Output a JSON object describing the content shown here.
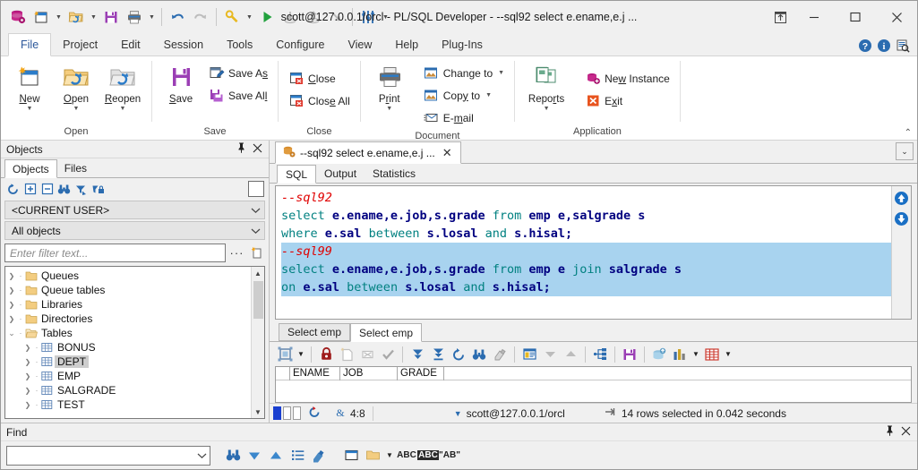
{
  "window": {
    "title": "scott@127.0.0.1/orcl - PL/SQL Developer - --sql92 select e.ename,e.j ...",
    "minimize": "—",
    "maximize": "▭",
    "close": "✕",
    "restore_icon": "restore-down-icon"
  },
  "quick_access": {
    "items": [
      {
        "name": "database-icon",
        "label": "Session"
      },
      {
        "name": "new-file-icon",
        "label": "New"
      },
      {
        "name": "open-folder-icon",
        "label": "Open"
      },
      {
        "name": "save-icon",
        "label": "Save"
      },
      {
        "name": "print-icon",
        "label": "Print"
      },
      {
        "name": "undo-icon",
        "label": "Undo"
      },
      {
        "name": "redo-icon",
        "label": "Redo"
      },
      {
        "name": "flashlight-icon",
        "label": "Explain Plan"
      },
      {
        "name": "execute-icon",
        "label": "Execute"
      },
      {
        "name": "commit-icon",
        "label": "Commit"
      },
      {
        "name": "rollback-icon",
        "label": "Rollback"
      },
      {
        "name": "break-icon",
        "label": "Break"
      },
      {
        "name": "preferences-icon",
        "label": "Preferences"
      }
    ]
  },
  "ribbon": {
    "tabs": [
      {
        "label": "File",
        "active": true
      },
      {
        "label": "Project",
        "active": false
      },
      {
        "label": "Edit",
        "active": false
      },
      {
        "label": "Session",
        "active": false
      },
      {
        "label": "Tools",
        "active": false
      },
      {
        "label": "Configure",
        "active": false
      },
      {
        "label": "View",
        "active": false
      },
      {
        "label": "Help",
        "active": false
      },
      {
        "label": "Plug-Ins",
        "active": false
      }
    ],
    "help_icons": [
      "help-icon",
      "info-icon",
      "find-document-icon"
    ],
    "collapse": "⌃",
    "groups": [
      {
        "title": "Open",
        "big_buttons": [
          {
            "label_pre": "",
            "label_u": "N",
            "label_post": "ew",
            "icon": "new-window-icon",
            "caret": true
          },
          {
            "label_pre": "",
            "label_u": "O",
            "label_post": "pen",
            "icon": "open-folder-icon",
            "caret": true
          },
          {
            "label_pre": "",
            "label_u": "R",
            "label_post": "eopen",
            "icon": "reopen-folder-icon",
            "caret": true
          }
        ]
      },
      {
        "title": "Save",
        "big_buttons": [
          {
            "label_pre": "",
            "label_u": "S",
            "label_post": "ave",
            "icon": "save-disk-icon",
            "caret": false
          }
        ],
        "small_buttons": [
          {
            "pre": "Save A",
            "u": "s",
            "post": "",
            "icon": "save-as-icon"
          },
          {
            "pre": "Save Al",
            "u": "l",
            "post": "",
            "icon": "save-all-icon"
          }
        ]
      },
      {
        "title": "Close",
        "small_buttons": [
          {
            "pre": "",
            "u": "C",
            "post": "lose",
            "icon": "close-window-icon"
          },
          {
            "pre": "Clos",
            "u": "e",
            "post": " All",
            "icon": "close-all-icon"
          }
        ]
      },
      {
        "title": "Document",
        "big_buttons": [
          {
            "label_pre": "P",
            "label_u": "r",
            "label_post": "int",
            "icon": "printer-icon",
            "caret": true
          }
        ],
        "small_buttons": [
          {
            "pre": "Chan",
            "u": "g",
            "post": "e to",
            "icon": "change-to-icon",
            "caret": true
          },
          {
            "pre": "Cop",
            "u": "y",
            "post": " to",
            "icon": "copy-to-icon",
            "caret": true
          },
          {
            "pre": "E-",
            "u": "m",
            "post": "ail",
            "icon": "email-icon"
          }
        ]
      },
      {
        "title": "Application",
        "big_buttons": [
          {
            "label_pre": "Repo",
            "label_u": "r",
            "label_post": "ts",
            "icon": "reports-icon",
            "caret": true
          }
        ],
        "small_buttons": [
          {
            "pre": "Ne",
            "u": "w",
            "post": " Instance",
            "icon": "new-instance-icon"
          },
          {
            "pre": "E",
            "u": "x",
            "post": "it",
            "icon": "exit-icon"
          }
        ]
      }
    ]
  },
  "objects_panel": {
    "caption": "Objects",
    "pin": "📌",
    "close": "✕",
    "tabs": [
      {
        "label": "Objects",
        "active": true
      },
      {
        "label": "Files",
        "active": false
      }
    ],
    "toolbar": [
      {
        "name": "refresh-icon"
      },
      {
        "name": "expand-all-icon"
      },
      {
        "name": "collapse-all-icon"
      },
      {
        "name": "find-binoculars-icon"
      },
      {
        "name": "filter-object-icon"
      },
      {
        "name": "lock-object-icon"
      }
    ],
    "user_selector": "<CURRENT USER>",
    "object_type_selector": "All objects",
    "filter_placeholder": "Enter filter text...",
    "filter_value": "",
    "filter_more": "···",
    "tree": [
      {
        "label": "Queues",
        "icon": "folder-icon",
        "expanded": false,
        "level": 0,
        "selected": false
      },
      {
        "label": "Queue tables",
        "icon": "folder-icon",
        "expanded": false,
        "level": 0,
        "selected": false
      },
      {
        "label": "Libraries",
        "icon": "folder-icon",
        "expanded": false,
        "level": 0,
        "selected": false
      },
      {
        "label": "Directories",
        "icon": "folder-icon",
        "expanded": false,
        "level": 0,
        "selected": false
      },
      {
        "label": "Tables",
        "icon": "folder-open-icon",
        "expanded": true,
        "level": 0,
        "selected": false
      },
      {
        "label": "BONUS",
        "icon": "table-icon",
        "expanded": false,
        "level": 1,
        "selected": false
      },
      {
        "label": "DEPT",
        "icon": "table-icon",
        "expanded": false,
        "level": 1,
        "selected": true
      },
      {
        "label": "EMP",
        "icon": "table-icon",
        "expanded": false,
        "level": 1,
        "selected": false
      },
      {
        "label": "SALGRADE",
        "icon": "table-icon",
        "expanded": false,
        "level": 1,
        "selected": false
      },
      {
        "label": "TEST",
        "icon": "table-icon",
        "expanded": false,
        "level": 1,
        "selected": false
      }
    ]
  },
  "document": {
    "tab_label": "--sql92 select e.ename,e.j ...",
    "tab_icon": "sql-window-icon",
    "tab_close": "✕",
    "tab_list_caret": "⌄",
    "sub_tabs": [
      {
        "label": "SQL",
        "active": true
      },
      {
        "label": "Output",
        "active": false
      },
      {
        "label": "Statistics",
        "active": false
      }
    ]
  },
  "editor": {
    "nav_up": "up-circle-icon",
    "nav_down": "down-circle-icon",
    "lines": [
      {
        "highlighted": false,
        "tokens": [
          {
            "t": "--sql92",
            "c": "cmt"
          }
        ]
      },
      {
        "highlighted": false,
        "tokens": [
          {
            "t": "select ",
            "c": "kw"
          },
          {
            "t": "e.ename,e.job,s.grade ",
            "c": "id"
          },
          {
            "t": "from ",
            "c": "kw"
          },
          {
            "t": "emp e,salgrade s",
            "c": "id"
          }
        ]
      },
      {
        "highlighted": false,
        "tokens": [
          {
            "t": "where ",
            "c": "kw"
          },
          {
            "t": "e.sal ",
            "c": "id"
          },
          {
            "t": "between ",
            "c": "kw"
          },
          {
            "t": "s.losal ",
            "c": "id"
          },
          {
            "t": "and ",
            "c": "kw"
          },
          {
            "t": "s.hisal",
            "c": "id"
          },
          {
            "t": ";",
            "c": "pn"
          }
        ]
      },
      {
        "highlighted": true,
        "tokens": [
          {
            "t": "--sql99",
            "c": "cmt"
          }
        ]
      },
      {
        "highlighted": true,
        "tokens": [
          {
            "t": "select ",
            "c": "kw"
          },
          {
            "t": "e.ename,e.job,s.grade ",
            "c": "id"
          },
          {
            "t": "from ",
            "c": "kw"
          },
          {
            "t": "emp e ",
            "c": "id"
          },
          {
            "t": "join ",
            "c": "kw"
          },
          {
            "t": "salgrade s",
            "c": "id"
          }
        ]
      },
      {
        "highlighted": true,
        "tokens": [
          {
            "t": "on ",
            "c": "kw"
          },
          {
            "t": "e.sal ",
            "c": "id"
          },
          {
            "t": "between ",
            "c": "kw"
          },
          {
            "t": "s.losal ",
            "c": "id"
          },
          {
            "t": "and ",
            "c": "kw"
          },
          {
            "t": "s.hisal",
            "c": "id"
          },
          {
            "t": ";",
            "c": "pn"
          }
        ]
      }
    ]
  },
  "results": {
    "tabs": [
      {
        "label": "Select emp",
        "active": false
      },
      {
        "label": "Select emp",
        "active": true
      }
    ],
    "toolbar": [
      {
        "name": "grid-layout-icon",
        "caret": true
      },
      {
        "name": "lock-record-icon",
        "caret": false
      },
      {
        "name": "insert-record-icon",
        "caret": false
      },
      {
        "name": "delete-record-icon",
        "caret": false
      },
      {
        "name": "post-changes-icon",
        "caret": false
      },
      {
        "name": "fetch-next-page-icon",
        "caret": false
      },
      {
        "name": "fetch-last-page-icon",
        "caret": false
      },
      {
        "name": "refresh-grid-icon",
        "caret": false
      },
      {
        "name": "find-grid-icon",
        "caret": false
      },
      {
        "name": "clear-filter-icon",
        "caret": false
      },
      {
        "name": "single-record-view-icon",
        "caret": false
      },
      {
        "name": "sort-descending-icon",
        "caret": false
      },
      {
        "name": "sort-ascending-icon",
        "caret": false
      },
      {
        "name": "export-structure-icon",
        "caret": false
      },
      {
        "name": "export-data-icon",
        "caret": false
      },
      {
        "name": "copy-to-database-icon",
        "caret": false
      },
      {
        "name": "chart-icon",
        "caret": true
      },
      {
        "name": "html-table-icon",
        "caret": true
      }
    ],
    "columns": [
      "",
      "ENAME",
      "JOB",
      "GRADE",
      ""
    ]
  },
  "statusbar": {
    "indicators": [
      "on",
      "off",
      "off"
    ],
    "transaction_icon": "rollback-status-icon",
    "session_icon": "session-icon",
    "cursor_position": "4:8",
    "connection_caret": "▼",
    "connection": "scott@127.0.0.1/orcl",
    "pin_icon": "pin-result-icon",
    "message": "14 rows selected in 0.042 seconds"
  },
  "find_panel": {
    "caption": "Find",
    "pin": "📌",
    "close": "✕",
    "search_value": "",
    "dropdown_caret": "⌄",
    "buttons": [
      {
        "name": "find-binoculars-icon",
        "label": "Find"
      },
      {
        "name": "find-next-icon",
        "label": "Find Next"
      },
      {
        "name": "find-previous-icon",
        "label": "Find Previous"
      },
      {
        "name": "find-list-icon",
        "label": "Find All"
      },
      {
        "name": "clear-highlight-icon",
        "label": "Clear"
      },
      {
        "name": "find-in-window-icon",
        "label": "Current Window"
      },
      {
        "name": "find-in-folder-icon",
        "label": "In Files",
        "caret": true
      },
      {
        "name": "match-case-icon",
        "label": "ABC"
      },
      {
        "name": "highlight-all-icon",
        "label": "ABC"
      },
      {
        "name": "whole-word-icon",
        "label": "\"AB\""
      }
    ]
  }
}
